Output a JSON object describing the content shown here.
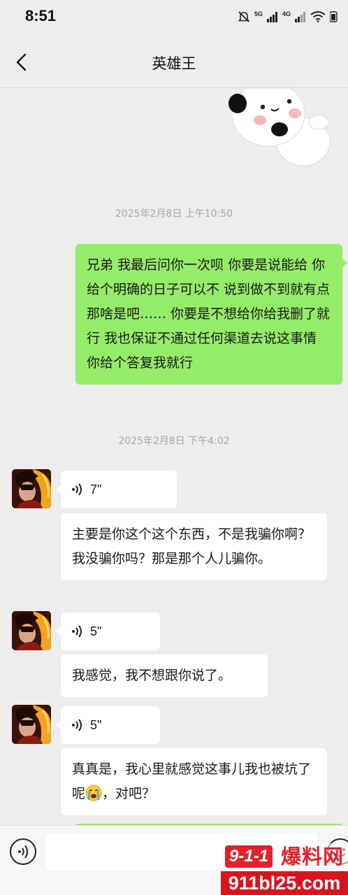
{
  "status_bar": {
    "time": "8:51",
    "network_1": "5G",
    "network_2": "4G"
  },
  "header": {
    "title": "英雄王"
  },
  "messages": [
    {
      "type": "sticker",
      "sender": "me",
      "sticker": "panda-sticker"
    },
    {
      "type": "timestamp",
      "text": "2025年2月8日 上午10:50"
    },
    {
      "type": "text",
      "sender": "me",
      "text": "兄弟 我最后问你一次呗 你要是说能给 你给个明确的日子可以不 说到做不到就有点那啥是吧…… 你要是不想给你给我删了就行 我也保证不通过任何渠道去说这事情 你给个答复我就行"
    },
    {
      "type": "timestamp",
      "text": "2025年2月8日 下午4:02"
    },
    {
      "type": "voice",
      "sender": "other",
      "duration": "7\"",
      "transcript": "主要是你这个这个东西，不是我骗你啊？我没骗你吗？那是那个人儿骗你。"
    },
    {
      "type": "voice",
      "sender": "other",
      "duration": "5\"",
      "transcript": "我感觉，我不想跟你说了。"
    },
    {
      "type": "voice",
      "sender": "other",
      "duration": "5\"",
      "transcript_before_emoji": "真真是，我心里就感觉这事儿我也被坑了呢",
      "emoji": "crying-emoji",
      "transcript_after_emoji": "，对吧？"
    }
  ],
  "watermark": {
    "logo": "9-1-1",
    "name": "爆料网",
    "url": "911bl25.com"
  },
  "colors": {
    "background": "#ededed",
    "outgoing_bubble": "#95ec69",
    "incoming_bubble": "#ffffff",
    "timestamp_text": "#a6a6a6",
    "watermark_red": "#e2222a"
  }
}
